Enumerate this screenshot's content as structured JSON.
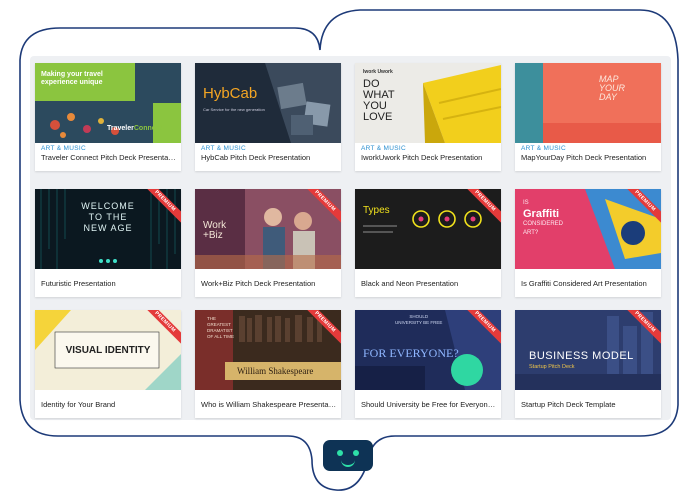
{
  "colors": {
    "outline": "#1d3a78",
    "accent_link": "#2a8fd0",
    "ribbon": "#e43a3a",
    "logo_bg": "#0e3355",
    "logo_eyes": "#2ee0a8"
  },
  "cards": [
    {
      "category": "ART & MUSIC",
      "title": "Traveler Connect Pitch Deck Presentation",
      "premium": false,
      "thumb": {
        "headline": "Making your travel experience unique",
        "brand": "Traveler",
        "brand2": "Connect"
      }
    },
    {
      "category": "ART & MUSIC",
      "title": "HybCab Pitch Deck Presentation",
      "premium": false,
      "thumb": {
        "brand": "HybCab",
        "sub": "Car Service for the new generation"
      }
    },
    {
      "category": "ART & MUSIC",
      "title": "IworkUwork Pitch Deck Presentation",
      "premium": false,
      "thumb": {
        "brand": "Iwork Uwork",
        "line1": "DO",
        "line2": "WHAT",
        "line3": "YOU",
        "line4": "LOVE"
      }
    },
    {
      "category": "ART & MUSIC",
      "title": "MapYourDay Pitch Deck Presentation",
      "premium": false,
      "thumb": {
        "line1": "MAP",
        "line2": "YOUR",
        "line3": "DAY"
      }
    },
    {
      "category": "",
      "title": "Futuristic Presentation",
      "premium": true,
      "thumb": {
        "line1": "WELCOME",
        "line2": "TO THE",
        "line3": "NEW AGE"
      }
    },
    {
      "category": "",
      "title": "Work+Biz Pitch Deck Presentation",
      "premium": true,
      "thumb": {
        "line1": "Work",
        "line2": "+Biz"
      }
    },
    {
      "category": "",
      "title": "Black and Neon Presentation",
      "premium": true,
      "thumb": {
        "line1": "Types"
      }
    },
    {
      "category": "",
      "title": "Is Graffiti Considered Art Presentation",
      "premium": true,
      "thumb": {
        "line1": "IS",
        "line2": "Graffiti",
        "line3": "CONSIDERED",
        "line4": "ART?"
      }
    },
    {
      "category": "",
      "title": "Identity for Your Brand",
      "premium": true,
      "thumb": {
        "line1": "VISUAL IDENTITY"
      }
    },
    {
      "category": "",
      "title": "Who is William Shakespeare Presentation",
      "premium": true,
      "thumb": {
        "line1": "THE",
        "line2": "GREATEST",
        "line3": "DRAMATIST",
        "line4": "OF ALL TIME",
        "line5": "William Shakespeare"
      }
    },
    {
      "category": "",
      "title": "Should University be Free for Everyone Presentation",
      "premium": true,
      "thumb": {
        "line1": "SHOULD",
        "line2": "UNIVERSITY BE FREE",
        "line3": "FOR EVERYONE?"
      }
    },
    {
      "category": "",
      "title": "Startup Pitch Deck Template",
      "premium": true,
      "thumb": {
        "line1": "BUSINESS MODEL",
        "line2": "Startup Pitch Deck"
      }
    }
  ],
  "ribbon_label": "PREMIUM",
  "logo": {
    "icon": "smiley-face-icon"
  }
}
